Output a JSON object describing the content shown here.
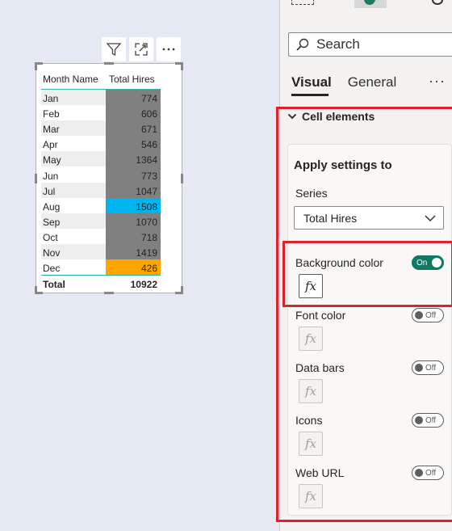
{
  "visual_header": {
    "icons": [
      "filter-icon",
      "focus-mode-icon",
      "more-options-icon"
    ]
  },
  "table": {
    "headers": [
      "Month Name",
      "Total Hires"
    ],
    "rows": [
      {
        "month": "Jan",
        "value": "774",
        "bg": "#808080"
      },
      {
        "month": "Feb",
        "value": "606",
        "bg": "#808080"
      },
      {
        "month": "Mar",
        "value": "671",
        "bg": "#808080"
      },
      {
        "month": "Apr",
        "value": "546",
        "bg": "#808080"
      },
      {
        "month": "May",
        "value": "1364",
        "bg": "#808080"
      },
      {
        "month": "Jun",
        "value": "773",
        "bg": "#808080"
      },
      {
        "month": "Jul",
        "value": "1047",
        "bg": "#808080"
      },
      {
        "month": "Aug",
        "value": "1508",
        "bg": "#00b4f0"
      },
      {
        "month": "Sep",
        "value": "1070",
        "bg": "#808080"
      },
      {
        "month": "Oct",
        "value": "718",
        "bg": "#808080"
      },
      {
        "month": "Nov",
        "value": "1419",
        "bg": "#808080"
      },
      {
        "month": "Dec",
        "value": "426",
        "bg": "#ffa500"
      }
    ],
    "total_label": "Total",
    "total_value": "10922"
  },
  "pane": {
    "search_placeholder": "Search",
    "tabs": [
      "Visual",
      "General"
    ],
    "more": "···",
    "section_title": "Cell elements",
    "apply_title": "Apply settings to",
    "series_label": "Series",
    "series_value": "Total Hires",
    "options": [
      {
        "label": "Background color",
        "toggle": "On"
      },
      {
        "label": "Font color",
        "toggle": "Off"
      },
      {
        "label": "Data bars",
        "toggle": "Off"
      },
      {
        "label": "Icons",
        "toggle": "Off"
      },
      {
        "label": "Web URL",
        "toggle": "Off"
      }
    ],
    "fx_label": "fx"
  },
  "colors": {
    "highlight_outline": "#e0202a",
    "toggle_on": "#117865"
  }
}
